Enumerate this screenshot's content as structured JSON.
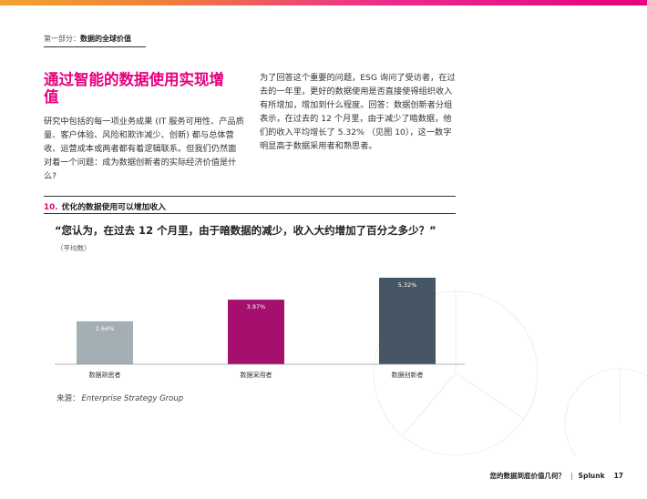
{
  "breadcrumb": {
    "section": "第一部分：",
    "title": "数据的全球价值"
  },
  "headline": "通过智能的数据使用实现增值",
  "intro": {
    "left": "研究中包括的每一项业务成果 (IT 服务可用性、产品质量、客户体验、风险和欺诈减少、创新) 都与总体营收、运营成本或两者都有着逻辑联系。但我们仍然面对着一个问题：成为数据创新者的实际经济价值是什么?",
    "right": "为了回答这个重要的问题，ESG 询问了受访者，在过去的一年里，更好的数据使用是否直接使得组织收入有所增加，增加到什么程度。回答：数据创新者分组表示，在过去的 12 个月里，由于减少了暗数据，他们的收入平均增长了 5.32% （见图 10），这一数字明显高于数据采用者和熟思者。"
  },
  "figure": {
    "number": "10.",
    "title": "优化的数据使用可以增加收入"
  },
  "question": "“您认为，在过去 12 个月里，由于暗数据的减少，收入大约增加了百分之多少？”",
  "subtitle": "（平均数）",
  "chart_data": {
    "type": "bar",
    "categories": [
      "数据熟思者",
      "数据采用者",
      "数据创新者"
    ],
    "values": [
      2.64,
      3.97,
      5.32
    ],
    "value_labels": [
      "2.64%",
      "3.97%",
      "5.32%"
    ],
    "ylim": [
      0,
      5.6
    ],
    "grid": false,
    "colors": [
      "#a3aeb5",
      "#a50f6e",
      "#465665"
    ]
  },
  "source": {
    "label": "来源：",
    "text": "Enterprise Strategy Group"
  },
  "footer": {
    "text": "您的数据到底价值几何？",
    "sep": "|",
    "brand": "Splunk",
    "page": "17"
  }
}
